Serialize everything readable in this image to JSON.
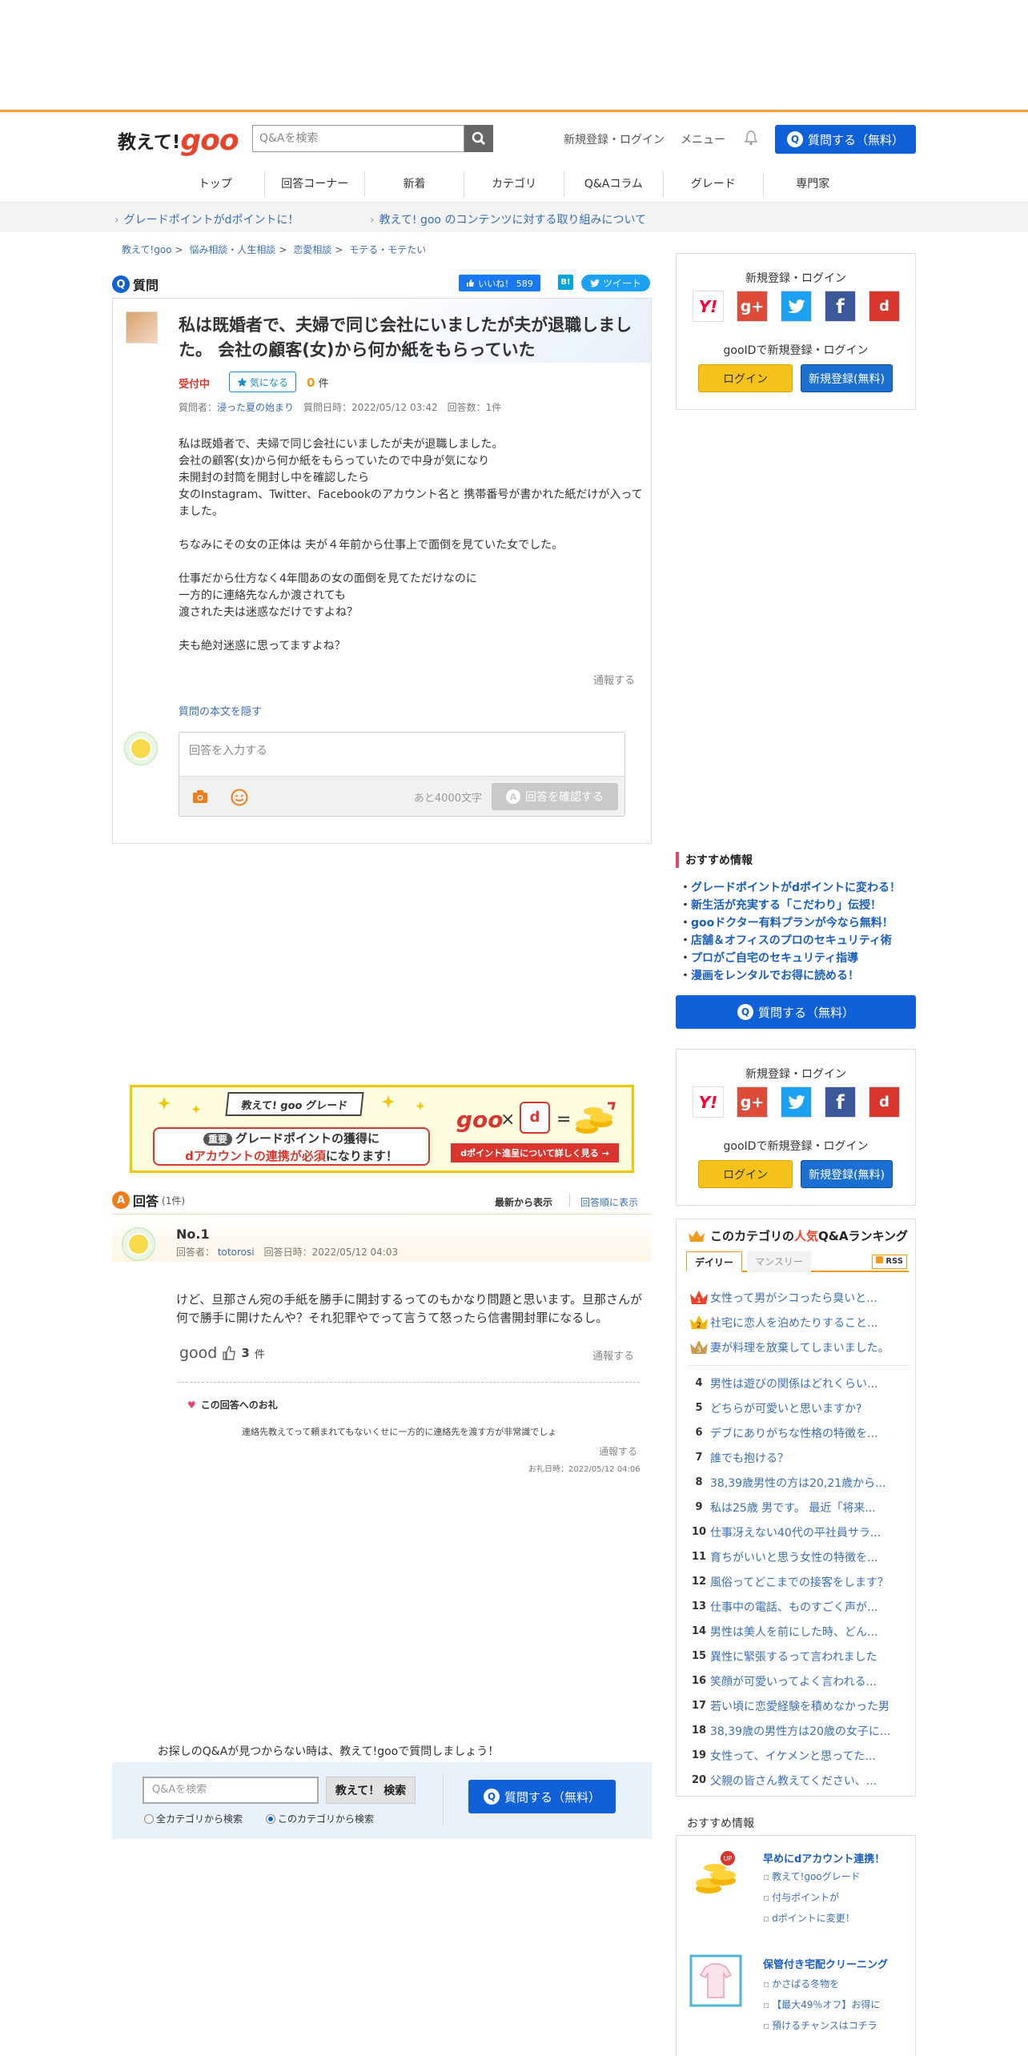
{
  "header": {
    "logo_text": "教えて!",
    "logo_goo": "goo",
    "search_placeholder": "Q&Aを検索",
    "signup_login": "新規登録・ログイン",
    "menu": "メニュー",
    "ask_button": "質問する（無料）"
  },
  "gnav": [
    "トップ",
    "回答コーナー",
    "新着",
    "カテゴリ",
    "Q&Aコラム",
    "グレード",
    "専門家"
  ],
  "infobar": {
    "link1": "グレードポイントがdポイントに！",
    "link2": "教えて! goo のコンテンツに対する取り組みについて"
  },
  "breadcrumb": [
    "教えて!goo",
    "悩み相談・人生相談",
    "恋愛相談",
    "モテる・モテたい"
  ],
  "question": {
    "section_label": "質問",
    "like_label": "いいね！ 589",
    "hatena_label": "B!",
    "tweet_label": "ツイート",
    "title": "私は既婚者で、夫婦で同じ会社にいましたが夫が退職しました。 会社の顧客(女)から何か紙をもらっていた",
    "status": "受付中",
    "kininaru_label": "気になる",
    "kininaru_count": "0",
    "kininaru_unit": "件",
    "meta_asker_label": "質問者：",
    "meta_asker": "浸った夏の始まり",
    "meta_rest": "質問日時：2022/05/12 03:42　回答数：1件",
    "body": "私は既婚者で、夫婦で同じ会社にいましたが夫が退職しました。\n会社の顧客(女)から何か紙をもらっていたので中身が気になり\n未開封の封筒を開封し中を確認したら\n女のInstagram、Twitter、Facebookのアカウント名と 携帯番号が書かれた紙だけが入ってました。\n\nちなみにその女の正体は 夫が４年前から仕事上で面倒を見ていた女でした。\n\n仕事だから仕方なく4年間あの女の面倒を見てただけなのに\n一方的に連絡先なんか渡されても\n渡された夫は迷惑なだけですよね？\n\n夫も絶対迷惑に思ってますよね？",
    "report": "通報する",
    "hide_body": "質問の本文を隠す",
    "answer_placeholder": "回答を入力する",
    "chars_left": "あと4000文字",
    "confirm_button": "回答を確認する"
  },
  "login_box": {
    "title": "新規登録・ログイン",
    "sub": "gooIDで新規登録・ログイン",
    "login_btn": "ログイン",
    "register_btn": "新規登録(無料)",
    "sns": [
      "Y!",
      "g+",
      "twitter",
      "f",
      "d"
    ]
  },
  "recommend": {
    "title": "おすすめ情報",
    "items": [
      "グレードポイントがdポイントに変わる！",
      "新生活が充実する「こだわり」伝授！",
      "gooドクター有料プランが今なら無料！",
      "店舗＆オフィスのプロのセキュリティ術",
      "プロがご自宅のセキュリティ指導",
      "漫画をレンタルでお得に読める！"
    ],
    "ask_button": "質問する（無料）"
  },
  "banner": {
    "tag": "教えて! goo グレード",
    "important": "重要",
    "line1": "グレードポイントの獲得に",
    "line2a": "dアカウントの連携が必須",
    "line2b": "になります！",
    "goo": "goo",
    "x": "×",
    "d": "d",
    "eq": "=",
    "bar": "dポイント進呈について詳しく見る →"
  },
  "answers": {
    "section_label": "回答",
    "count": "(1件)",
    "sort_new": "最新から表示",
    "sort_order": "回答順に表示",
    "no": "No.1",
    "meta_label": "回答者：",
    "meta_user": "totorosi",
    "meta_date": "回答日時：2022/05/12 04:03",
    "body": "けど、旦那さん宛の手紙を勝手に開封するってのもかなり問題と思います。旦那さんが何で勝手に開けたんや？それ犯罪やでって言うて怒ったら信書開封罪になるし。",
    "good_label": "good",
    "good_count": "3",
    "good_unit": "件",
    "report": "通報する",
    "thanks_title": "この回答へのお礼",
    "thanks_body": "連絡先教えてって頼まれてもないくせに一方的に連絡先を渡す方が非常識でしょ",
    "thanks_report": "通報する",
    "thanks_date": "お礼日時：2022/05/12 04:06"
  },
  "ranking": {
    "title_a": "このカテゴリの",
    "title_b": "人気",
    "title_c": "Q&Aランキング",
    "tab_daily": "デイリー",
    "tab_monthly": "マンスリー",
    "rss": "RSS",
    "items": [
      {
        "num": "1",
        "text": "女性って男がシコったら臭いと..."
      },
      {
        "num": "2",
        "text": "社宅に恋人を泊めたりすること..."
      },
      {
        "num": "3",
        "text": "妻が料理を放棄してしまいました。"
      },
      {
        "num": "4",
        "text": "男性は遊びの関係はどれくらい..."
      },
      {
        "num": "5",
        "text": "どちらが可愛いと思いますか?"
      },
      {
        "num": "6",
        "text": "デブにありがちな性格の特徴を..."
      },
      {
        "num": "7",
        "text": "誰でも抱ける？"
      },
      {
        "num": "8",
        "text": "38,39歳男性の方は20,21歳から..."
      },
      {
        "num": "9",
        "text": "私は25歳 男です。 最近「将来..."
      },
      {
        "num": "10",
        "text": "仕事冴えない40代の平社員サラ..."
      },
      {
        "num": "11",
        "text": "育ちがいいと思う女性の特徴を..."
      },
      {
        "num": "12",
        "text": "風俗ってどこまでの接客をします？"
      },
      {
        "num": "13",
        "text": "仕事中の電話、ものすごく声が..."
      },
      {
        "num": "14",
        "text": "男性は美人を前にした時、どん..."
      },
      {
        "num": "15",
        "text": "異性に緊張するって言われました"
      },
      {
        "num": "16",
        "text": "笑顔が可愛いってよく言われる..."
      },
      {
        "num": "17",
        "text": "若い頃に恋愛経験を積めなかった男"
      },
      {
        "num": "18",
        "text": "38,39歳の男性方は20歳の女子に..."
      },
      {
        "num": "19",
        "text": "女性って、イケメンと思ってた..."
      },
      {
        "num": "20",
        "text": "父親の皆さん教えてください、..."
      }
    ]
  },
  "bottom": {
    "note": "お探しのQ&Aが見つからない時は、教えて!gooで質問しましょう！",
    "search_placeholder": "Q&Aを検索",
    "search_button": "教えて！ 検索",
    "radio_all": "全カテゴリから検索",
    "radio_this": "このカテゴリから検索",
    "ask_button": "質問する（無料）"
  },
  "recommend2": {
    "title": "おすすめ情報",
    "block1_title": "早めにdアカウント連携！",
    "block1_lines": [
      "教えて!gooグレード",
      "付与ポイントが",
      "dポイントに変更！"
    ],
    "block2_title": "保管付き宅配クリーニング",
    "block2_lines": [
      "かさばる冬物を",
      "【最大49％オフ】お得に",
      "預けるチャンスはコチラ"
    ]
  }
}
